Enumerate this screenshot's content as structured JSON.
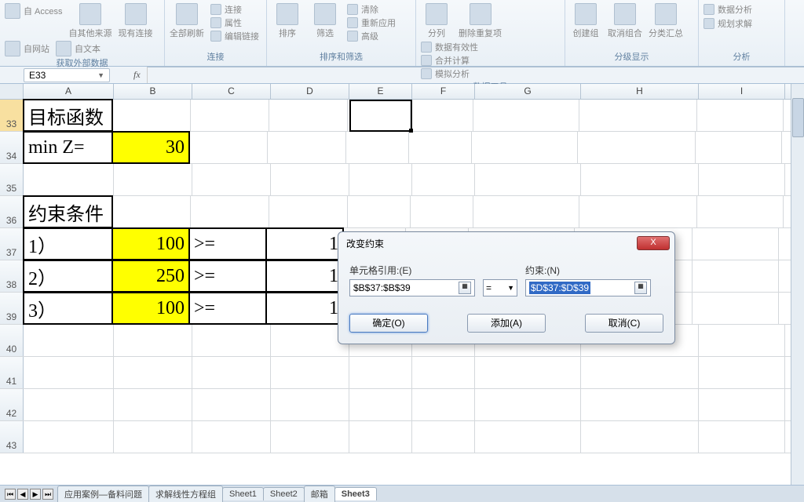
{
  "ribbon": {
    "groups": [
      {
        "title": "获取外部数据",
        "items": [
          "自 Access",
          "自网站",
          "自文本",
          "自其他来源",
          "现有连接"
        ]
      },
      {
        "title": "连接",
        "items": [
          "全部刷新",
          "连接",
          "属性",
          "编辑链接"
        ]
      },
      {
        "title": "排序和筛选",
        "items": [
          "排序",
          "筛选",
          "清除",
          "重新应用",
          "高级"
        ]
      },
      {
        "title": "数据工具",
        "items": [
          "分列",
          "删除重复项",
          "数据有效性",
          "合并计算",
          "模拟分析"
        ]
      },
      {
        "title": "分级显示",
        "items": [
          "创建组",
          "取消组合",
          "分类汇总"
        ]
      },
      {
        "title": "分析",
        "items": [
          "数据分析",
          "规划求解"
        ]
      }
    ]
  },
  "namebox": "E33",
  "columns": [
    "A",
    "B",
    "C",
    "D",
    "E",
    "F",
    "G",
    "H",
    "I"
  ],
  "rows": [
    "33",
    "34",
    "35",
    "36",
    "37",
    "38",
    "39",
    "40",
    "41",
    "42",
    "43"
  ],
  "cells": {
    "a33": "目标函数",
    "a34": "min Z=",
    "b34": "30",
    "a36": "约束条件",
    "a37": "1）",
    "b37": "100",
    "c37": ">=",
    "d37": "1",
    "a38": "2）",
    "b38": "250",
    "c38": ">=",
    "d38": "1",
    "a39": "3）",
    "b39": "100",
    "c39": ">=",
    "d39": "1"
  },
  "dialog": {
    "title": "改变约束",
    "cell_ref_label": "单元格引用:(E)",
    "cell_ref_value": "$B$37:$B$39",
    "operator": "=",
    "constraint_label": "约束:(N)",
    "constraint_value": "$D$37:$D$39",
    "ok": "确定(O)",
    "add": "添加(A)",
    "cancel": "取消(C)",
    "close": "X"
  },
  "tabs": [
    "应用案例—备料问题",
    "求解线性方程组",
    "Sheet1",
    "Sheet2",
    "邮箱",
    "Sheet3"
  ],
  "active_tab": 5
}
